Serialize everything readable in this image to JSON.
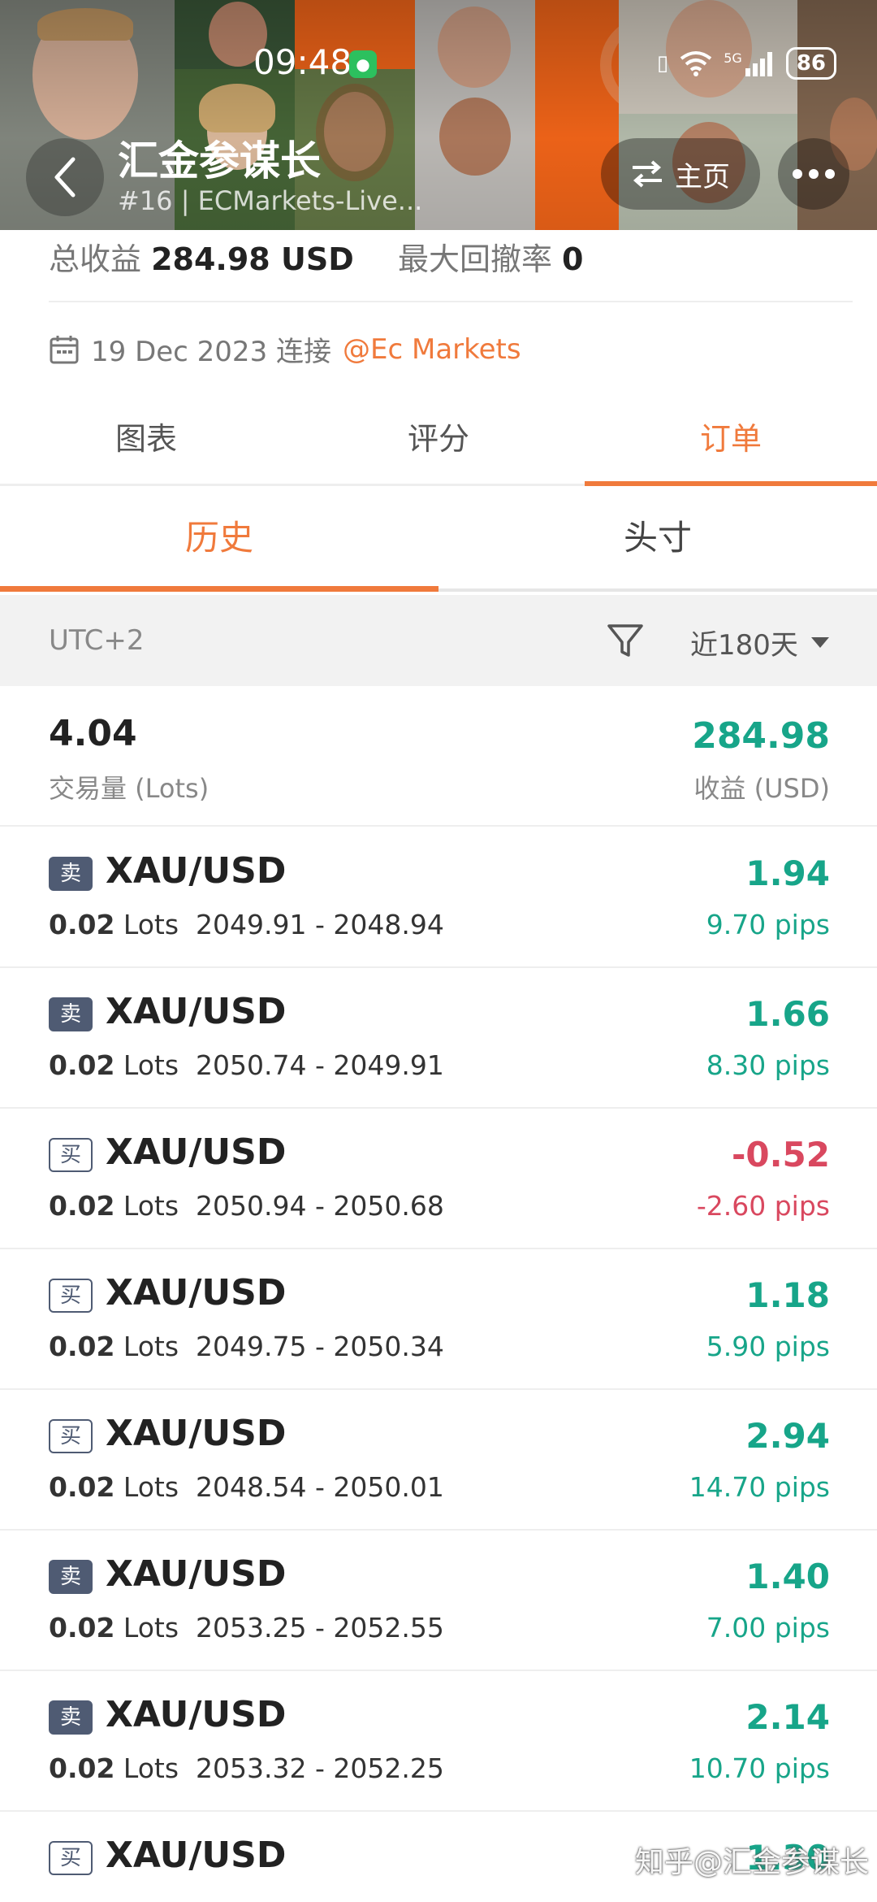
{
  "status_bar": {
    "time": "09:48",
    "network": "5G",
    "battery": "86"
  },
  "header": {
    "title": "汇金参谋长",
    "subtitle": "#16 | ECMarkets-Live...",
    "home_label": "主页"
  },
  "summary": {
    "total_profit_label": "总收益",
    "total_profit_value": "284.98 USD",
    "max_drawdown_label": "最大回撤率",
    "max_drawdown_value": "0",
    "connect_date": "19 Dec 2023 连接",
    "broker": "@Ec Markets"
  },
  "tabs": [
    {
      "label": "图表"
    },
    {
      "label": "评分"
    },
    {
      "label": "订单"
    }
  ],
  "subtabs": [
    {
      "label": "历史"
    },
    {
      "label": "头寸"
    }
  ],
  "filter": {
    "timezone": "UTC+2",
    "period": "近180天"
  },
  "totals": {
    "lots": "4.04",
    "lots_label": "交易量 (Lots)",
    "profit": "284.98",
    "profit_label": "收益 (USD)"
  },
  "orders": [
    {
      "side": "卖",
      "type": "sell",
      "symbol": "XAU/USD",
      "lots": "0.02",
      "lots_unit": "Lots",
      "prices": "2049.91 - 2048.94",
      "pl": "1.94",
      "pips": "9.70 pips"
    },
    {
      "side": "卖",
      "type": "sell",
      "symbol": "XAU/USD",
      "lots": "0.02",
      "lots_unit": "Lots",
      "prices": "2050.74 - 2049.91",
      "pl": "1.66",
      "pips": "8.30 pips"
    },
    {
      "side": "买",
      "type": "buy",
      "symbol": "XAU/USD",
      "lots": "0.02",
      "lots_unit": "Lots",
      "prices": "2050.94 - 2050.68",
      "pl": "-0.52",
      "pips": "-2.60 pips"
    },
    {
      "side": "买",
      "type": "buy",
      "symbol": "XAU/USD",
      "lots": "0.02",
      "lots_unit": "Lots",
      "prices": "2049.75 - 2050.34",
      "pl": "1.18",
      "pips": "5.90 pips"
    },
    {
      "side": "买",
      "type": "buy",
      "symbol": "XAU/USD",
      "lots": "0.02",
      "lots_unit": "Lots",
      "prices": "2048.54 - 2050.01",
      "pl": "2.94",
      "pips": "14.70 pips"
    },
    {
      "side": "卖",
      "type": "sell",
      "symbol": "XAU/USD",
      "lots": "0.02",
      "lots_unit": "Lots",
      "prices": "2053.25 - 2052.55",
      "pl": "1.40",
      "pips": "7.00 pips"
    },
    {
      "side": "卖",
      "type": "sell",
      "symbol": "XAU/USD",
      "lots": "0.02",
      "lots_unit": "Lots",
      "prices": "2053.32 - 2052.25",
      "pl": "2.14",
      "pips": "10.70 pips"
    },
    {
      "side": "买",
      "type": "buy",
      "symbol": "XAU/USD",
      "lots": "",
      "lots_unit": "",
      "prices": "",
      "pl": "1.30",
      "pips": ""
    }
  ],
  "watermark": "知乎@汇金参谋长",
  "colors": {
    "accent": "#f07a3c",
    "profit": "#17a589",
    "loss": "#d9485f",
    "badge": "#4f5b73"
  },
  "icons": [
    "back-arrow-icon",
    "swap-icon",
    "more-icon",
    "calendar-icon",
    "filter-icon",
    "caret-down-icon",
    "wechat-icon",
    "vibrate-icon",
    "wifi-icon",
    "signal-icon"
  ]
}
